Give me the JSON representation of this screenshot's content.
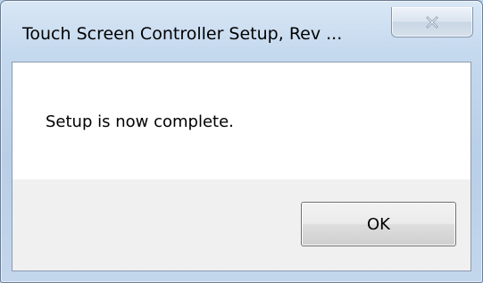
{
  "dialog": {
    "title": "Touch Screen Controller Setup, Rev ...",
    "message": "Setup is now complete.",
    "ok_label": "OK",
    "close_icon": "close-icon"
  },
  "colors": {
    "frame": "#c5d9ee",
    "client_background": "#ffffff",
    "button_bar": "#f0f0f0"
  }
}
